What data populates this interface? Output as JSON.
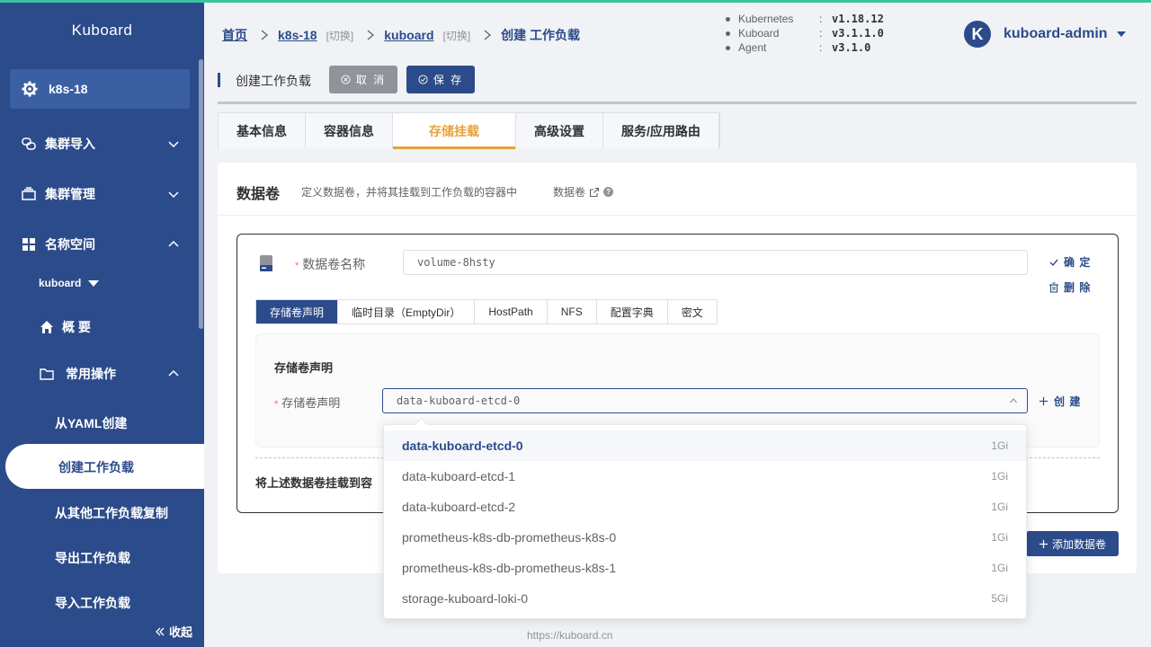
{
  "sidebar": {
    "title": "Kuboard",
    "cluster": "k8s-18",
    "items": [
      {
        "label": "集群导入"
      },
      {
        "label": "集群管理"
      },
      {
        "label": "名称空间"
      }
    ],
    "namespace": "kuboard",
    "overview": "概 要",
    "common_ops": "常用操作",
    "sub_items": [
      {
        "label": "从YAML创建"
      },
      {
        "label": "创建工作负载"
      },
      {
        "label": "从其他工作负载复制"
      },
      {
        "label": "导出工作负载"
      },
      {
        "label": "导入工作负载"
      }
    ],
    "collapse": "收起"
  },
  "header": {
    "breadcrumb": {
      "home": "首页",
      "cluster": "k8s-18",
      "switch1": "[切换]",
      "namespace": "kuboard",
      "switch2": "[切换]",
      "current": "创建 工作负载"
    },
    "versions": [
      {
        "name": "Kubernetes",
        "colon": ":",
        "value": "v1.18.12"
      },
      {
        "name": "Kuboard",
        "colon": ":",
        "value": "v3.1.1.0"
      },
      {
        "name": "Agent",
        "colon": ":",
        "value": "v3.1.0"
      }
    ],
    "avatar_letter": "K",
    "user": "kuboard-admin"
  },
  "toolbar": {
    "title": "创建工作负载",
    "cancel": "取 消",
    "save": "保 存"
  },
  "tabs": [
    {
      "label": "基本信息"
    },
    {
      "label": "容器信息"
    },
    {
      "label": "存储挂载"
    },
    {
      "label": "高级设置"
    },
    {
      "label": "服务/应用路由"
    }
  ],
  "card": {
    "title": "数据卷",
    "desc": "定义数据卷，并将其挂载到工作负载的容器中",
    "link": "数据卷"
  },
  "volume": {
    "required": "*",
    "name_label": "数据卷名称",
    "name_value": "volume-8hsty",
    "confirm": "确 定",
    "delete": "删 除",
    "subtabs": [
      {
        "label": "存储卷声明"
      },
      {
        "label": "临时目录（EmptyDir）"
      },
      {
        "label": "HostPath"
      },
      {
        "label": "NFS"
      },
      {
        "label": "配置字典"
      },
      {
        "label": "密文"
      }
    ],
    "pvc_title": "存储卷声明",
    "pvc_label": "存储卷声明",
    "pvc_value": "data-kuboard-etcd-0",
    "create": "创 建",
    "mount_text": "将上述数据卷挂载到容"
  },
  "add_volume": "添加数据卷",
  "dropdown": [
    {
      "name": "data-kuboard-etcd-0",
      "size": "1Gi"
    },
    {
      "name": "data-kuboard-etcd-1",
      "size": "1Gi"
    },
    {
      "name": "data-kuboard-etcd-2",
      "size": "1Gi"
    },
    {
      "name": "prometheus-k8s-db-prometheus-k8s-0",
      "size": "1Gi"
    },
    {
      "name": "prometheus-k8s-db-prometheus-k8s-1",
      "size": "1Gi"
    },
    {
      "name": "storage-kuboard-loki-0",
      "size": "5Gi"
    }
  ],
  "footer": "https://kuboard.cn",
  "colors": {
    "primary": "#2c4b8a",
    "accent": "#e6a23c",
    "danger": "#f56c6c",
    "top_line": "#3bc3a0"
  }
}
